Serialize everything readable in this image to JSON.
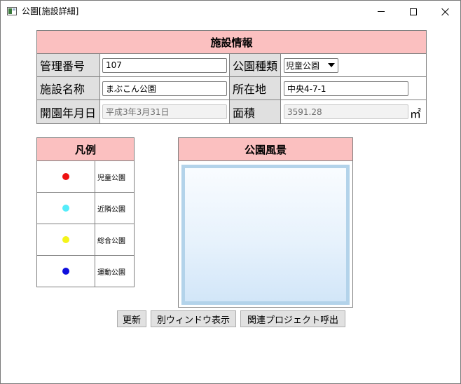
{
  "window": {
    "title": "公園[施設詳細]"
  },
  "facility_info": {
    "header": "施設情報",
    "management_number_label": "管理番号",
    "management_number_value": "107",
    "park_type_label": "公園種類",
    "park_type_value": "児童公園",
    "facility_name_label": "施設名称",
    "facility_name_value": "まぶこん公園",
    "location_label": "所在地",
    "location_value": "中央4-7-1",
    "opening_date_label": "開園年月日",
    "opening_date_value": "平成3年3月31日",
    "area_label": "面積",
    "area_value": "3591.28",
    "area_unit": "㎡"
  },
  "legend": {
    "header": "凡例",
    "items": [
      {
        "label": "児童公園",
        "color": "#ee1111"
      },
      {
        "label": "近隣公園",
        "color": "#55ecfa"
      },
      {
        "label": "総合公園",
        "color": "#f4f41a"
      },
      {
        "label": "運動公園",
        "color": "#1010dd"
      }
    ]
  },
  "scenery": {
    "header": "公園風景"
  },
  "buttons": {
    "update": "更新",
    "separate_window": "別ウィンドウ表示",
    "related_project": "関連プロジェクト呼出"
  }
}
